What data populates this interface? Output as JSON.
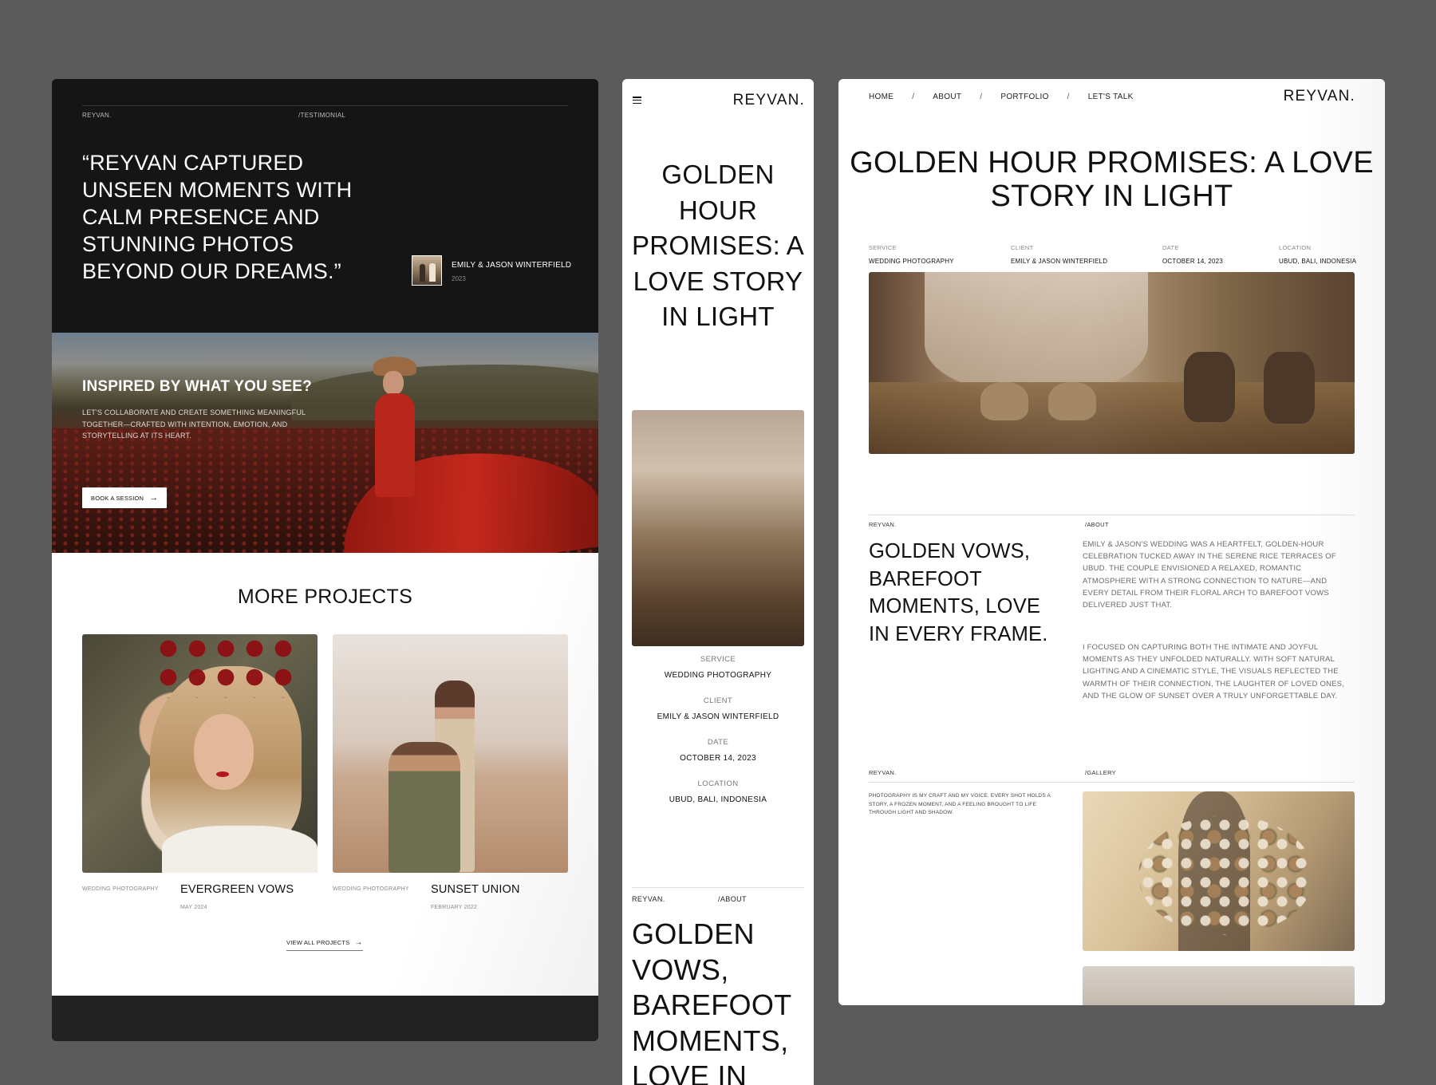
{
  "left": {
    "brand": "REYVAN.",
    "section": "/TESTIMONIAL",
    "quote": "“REYVAN CAPTURED UNSEEN MOMENTS WITH CALM PRESENCE AND STUNNING PHOTOS BEYOND OUR DREAMS.”",
    "client_name": "EMILY & JASON WINTERFIELD",
    "client_year": "2023",
    "cta_title": "INSPIRED BY WHAT YOU SEE?",
    "cta_text": "LET'S COLLABORATE AND CREATE SOMETHING MEANINGFUL TOGETHER—CRAFTED WITH INTENTION, EMOTION, AND STORYTELLING AT ITS HEART.",
    "cta_button": "BOOK A SESSION",
    "more_title": "MORE PROJECTS",
    "projects": [
      {
        "category": "WEDDING PHOTOGRAPHY",
        "name": "EVERGREEN VOWS",
        "date": "MAY 2024"
      },
      {
        "category": "WEDDING PHOTOGRAPHY",
        "name": "SUNSET UNION",
        "date": "FEBRUARY 2022"
      }
    ],
    "view_all": "VIEW ALL PROJECTS"
  },
  "mid": {
    "logo": "REYVAN.",
    "title": "GOLDEN HOUR PROMISES: A LOVE STORY IN LIGHT",
    "meta": [
      {
        "label": "SERVICE",
        "value": "WEDDING PHOTOGRAPHY"
      },
      {
        "label": "CLIENT",
        "value": "EMILY & JASON WINTERFIELD"
      },
      {
        "label": "DATE",
        "value": "OCTOBER 14, 2023"
      },
      {
        "label": "LOCATION",
        "value": "UBUD, BALI, INDONESIA"
      }
    ],
    "brand": "REYVAN.",
    "about": "/ABOUT",
    "vows_title": "GOLDEN VOWS, BAREFOOT MOMENTS, LOVE IN"
  },
  "right": {
    "nav": [
      "HOME",
      "ABOUT",
      "PORTFOLIO",
      "LET'S TALK"
    ],
    "nav_sep": "/",
    "logo": "REYVAN.",
    "title": "GOLDEN HOUR PROMISES: A LOVE STORY IN LIGHT",
    "meta": [
      {
        "label": "SERVICE",
        "value": "WEDDING PHOTOGRAPHY"
      },
      {
        "label": "CLIENT",
        "value": "EMILY & JASON WINTERFIELD"
      },
      {
        "label": "DATE",
        "value": "OCTOBER 14, 2023"
      },
      {
        "label": "LOCATION",
        "value": "UBUD, BALI, INDONESIA"
      }
    ],
    "brand": "REYVAN.",
    "about": "/ABOUT",
    "vows_title": "GOLDEN VOWS, BAREFOOT MOMENTS, LOVE IN EVERY FRAME.",
    "para1": "EMILY & JASON'S WEDDING WAS A HEARTFELT, GOLDEN-HOUR CELEBRATION TUCKED AWAY IN THE SERENE RICE TERRACES OF UBUD. THE COUPLE ENVISIONED A RELAXED, ROMANTIC ATMOSPHERE WITH A STRONG CONNECTION TO NATURE—AND EVERY DETAIL FROM THEIR FLORAL ARCH TO BAREFOOT VOWS DELIVERED JUST THAT.",
    "para2": "I FOCUSED ON CAPTURING BOTH THE INTIMATE AND JOYFUL MOMENTS AS THEY UNFOLDED NATURALLY. WITH SOFT NATURAL LIGHTING AND A CINEMATIC STYLE, THE VISUALS REFLECTED THE WARMTH OF THEIR CONNECTION, THE LAUGHTER OF LOVED ONES, AND THE GLOW OF SUNSET OVER A TRULY UNFORGETTABLE DAY.",
    "brand2": "REYVAN.",
    "gallery": "/GALLERY",
    "gallery_text": "PHOTOGRAPHY IS MY CRAFT AND MY VOICE. EVERY SHOT HOLDS A STORY, A FROZEN MOMENT, AND A FEELING BROUGHT TO LIFE THROUGH LIGHT AND SHADOW."
  },
  "icons": {
    "menu": "hamburger-menu-icon",
    "arrow": "arrow-right-icon"
  }
}
